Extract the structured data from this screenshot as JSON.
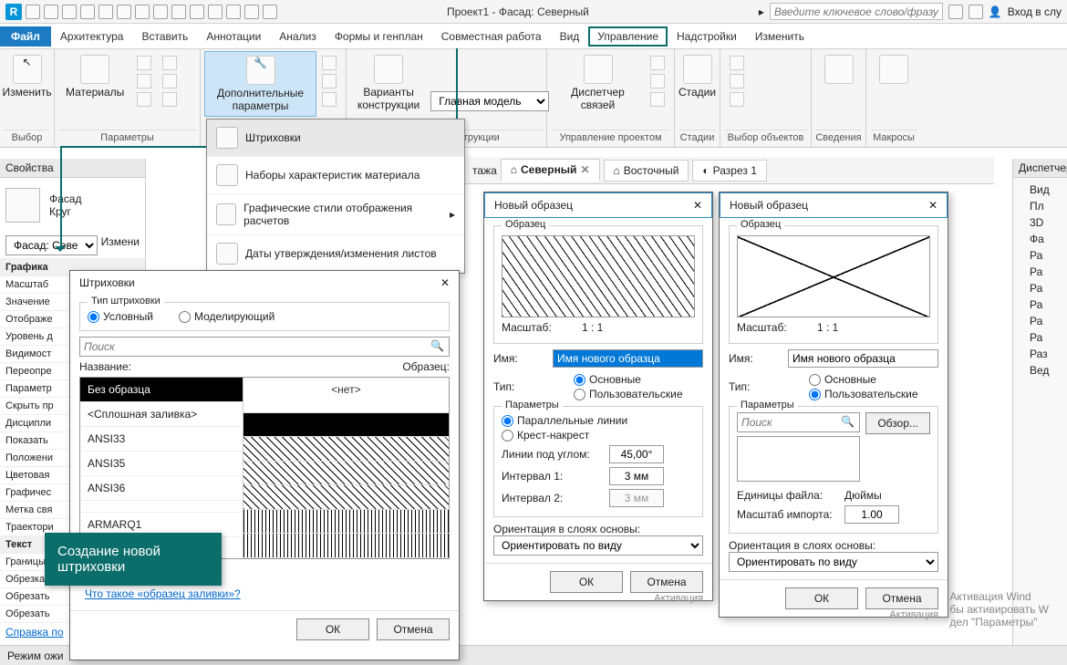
{
  "title": "Проект1 - Фасад: Северный",
  "search_placeholder": "Введите ключевое слово/фразу",
  "login": "Вход в слу",
  "menu": {
    "file": "Файл",
    "items": [
      "Архитектура",
      "Вставить",
      "Аннотации",
      "Анализ",
      "Формы и генплан",
      "Совместная работа",
      "Вид",
      "Управление",
      "Надстройки",
      "Изменить"
    ]
  },
  "ribbon": {
    "modify": "Изменить",
    "select": "Выбор",
    "materials": "Материалы",
    "params": "Параметры",
    "addl": "Дополнительные параметры",
    "design_opts": "Варианты конструкции",
    "main_model": "Главная модель",
    "design_opts_group": "Варианты конструкции",
    "links_mgr": "Диспетчер связей",
    "proj_mgmt": "Управление проектом",
    "phases": "Стадии",
    "phases_group": "Стадии",
    "sel_objects": "Выбор объектов",
    "info": "Сведения",
    "macros": "Макросы"
  },
  "dropdown": {
    "hatches": "Штриховки",
    "mat_sets": "Наборы характеристик материала",
    "calc_styles": "Графические стили отображения расчетов",
    "sheet_dates": "Даты утверждения/изменения листов"
  },
  "tabs": {
    "plan": "тажа",
    "north": "Северный",
    "east": "Восточный",
    "section": "Разрез 1"
  },
  "props": {
    "header": "Свойства",
    "facade": "Фасад",
    "circle": "Круг",
    "type_sel": "Фасад: Северный",
    "edit": "Измени",
    "graphics": "Графика",
    "rows": [
      "Масштаб",
      "Значение",
      "Отображе",
      "Уровень д",
      "Видимост",
      "Переопре",
      "Параметр",
      "Скрыть пр",
      "Дисципли",
      "Показать",
      "Положени",
      "Цветовая",
      "Графичес",
      "Метка свя",
      "Траектори"
    ],
    "text_section": "Текст",
    "text_rows": [
      "Границы",
      "Обрезка",
      "Обрезать",
      "Обрезать"
    ],
    "help": "Справка по"
  },
  "fill_dlg": {
    "title": "Штриховки",
    "pattern_type": "Тип штриховки",
    "conditional": "Условный",
    "modeling": "Моделирующий",
    "search": "Поиск",
    "name_col": "Название:",
    "sample_col": "Образец:",
    "items": [
      "Без образца",
      "<Сплошная заливка>",
      "ANSI33",
      "ANSI35",
      "ANSI36",
      "",
      "ARMARQ1"
    ],
    "none_text": "<нет>",
    "what_is": "Что такое «образец заливки»?",
    "ok": "ОК",
    "cancel": "Отмена"
  },
  "new_dlg": {
    "title": "Новый образец",
    "sample": "Образец",
    "scale": "Масштаб:",
    "scale_val": "1 : 1",
    "name": "Имя:",
    "name_val": "Имя нового образца",
    "type": "Тип:",
    "basic": "Основные",
    "custom": "Пользовательские",
    "params": "Параметры",
    "parallel": "Параллельные линии",
    "cross": "Крест-накрест",
    "angle": "Линии под углом:",
    "angle_val": "45,00°",
    "int1": "Интервал 1:",
    "int1_val": "3 мм",
    "int2": "Интервал 2:",
    "int2_val": "3 мм",
    "orient": "Ориентация в слоях основы:",
    "orient_val": "Ориентировать по виду",
    "search": "Поиск",
    "browse": "Обзор...",
    "file_units": "Единицы файла:",
    "inches": "Дюймы",
    "import_scale": "Масштаб импорта:",
    "import_val": "1.00",
    "ok": "ОК",
    "cancel": "Отмена"
  },
  "callout": "Создание новой штриховки",
  "tree": {
    "header": "Диспетчер",
    "items": [
      "Вид",
      "Пл",
      "3D",
      "Фа",
      "Ра",
      "Ра",
      "Ра",
      "Ра",
      "Ра",
      "Ра",
      "Раз",
      "Вед"
    ]
  },
  "status": "Режим ожи",
  "watermark": "Активация Wind",
  "watermark2": "бы активировать W",
  "watermark3": "дел \"Параметры\"",
  "activation": "Активация"
}
